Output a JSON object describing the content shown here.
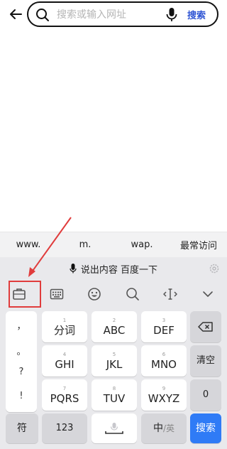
{
  "topbar": {
    "search_placeholder": "搜索或输入网址",
    "search_button": "搜索"
  },
  "quick_row": {
    "items": [
      "www.",
      "m.",
      "wap.",
      "最常访问"
    ]
  },
  "keyboard": {
    "voice_text": "说出内容 百度一下",
    "toolbar_icons": [
      "toolbox-icon",
      "keyboard-layout-icon",
      "emoji-icon",
      "search-icon",
      "cursor-move-icon",
      "collapse-chevron-icon"
    ],
    "punctuation": [
      "，",
      "。",
      "?",
      "!"
    ],
    "keys": {
      "k1": {
        "num": "1",
        "label": "分词"
      },
      "k2": {
        "num": "2",
        "label": "ABC"
      },
      "k3": {
        "num": "3",
        "label": "DEF"
      },
      "k4": {
        "num": "4",
        "label": "GHI"
      },
      "k5": {
        "num": "5",
        "label": "JKL"
      },
      "k6": {
        "num": "6",
        "label": "MNO"
      },
      "k7": {
        "num": "7",
        "label": "PQRS"
      },
      "k8": {
        "num": "8",
        "label": "TUV"
      },
      "k9": {
        "num": "9",
        "label": "WXYZ"
      },
      "clear": "清空",
      "zero": "0",
      "symbol": "符",
      "numeric": "123",
      "lang_cn": "中",
      "lang_sep": "/",
      "lang_en": "英",
      "search": "搜索"
    }
  },
  "colors": {
    "accent": "#2f55d4",
    "search_key": "#2f7bf6",
    "annotation": "#e03c3c"
  }
}
